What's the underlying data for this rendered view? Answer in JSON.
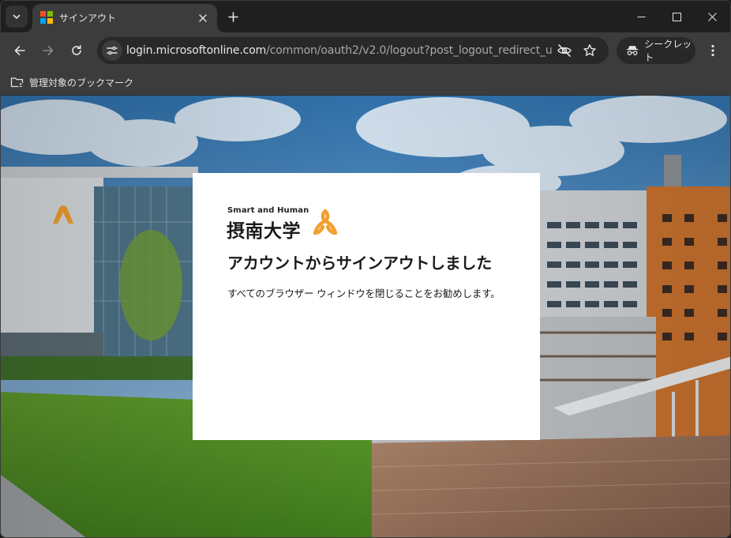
{
  "tab": {
    "title": "サインアウト",
    "favicon_colors": [
      "#f25022",
      "#7fba00",
      "#00a4ef",
      "#ffb900"
    ]
  },
  "toolbar": {
    "url_host": "login.microsoftonline.com",
    "url_path": "/common/oauth2/v2.0/logout?post_logout_redirect_uri=ht...",
    "incognito_label": "シークレット"
  },
  "bookmarks": {
    "managed_label": "管理対象のブックマーク"
  },
  "brand": {
    "tagline": "Smart and Human",
    "name": "摂南大学",
    "accent_color": "#f0a030"
  },
  "signout": {
    "title": "アカウントからサインアウトしました",
    "message": "すべてのブラウザー ウィンドウを閉じることをお勧めします。"
  },
  "icons": {
    "tab_search": "chevron-down-icon",
    "close_tab": "close-icon",
    "new_tab": "plus-icon",
    "back": "arrow-left-icon",
    "forward": "arrow-right-icon",
    "reload": "reload-icon",
    "site_info": "tune-icon",
    "tracking": "eye-off-icon",
    "bookmark": "star-icon",
    "incognito": "incognito-icon",
    "menu": "kebab-menu-icon",
    "managed_bookmarks": "folder-managed-icon"
  },
  "colors": {
    "chrome_dark": "#1f1f1f",
    "toolbar": "#3c3c3c",
    "omnibox": "#282828",
    "card": "#ffffff"
  }
}
